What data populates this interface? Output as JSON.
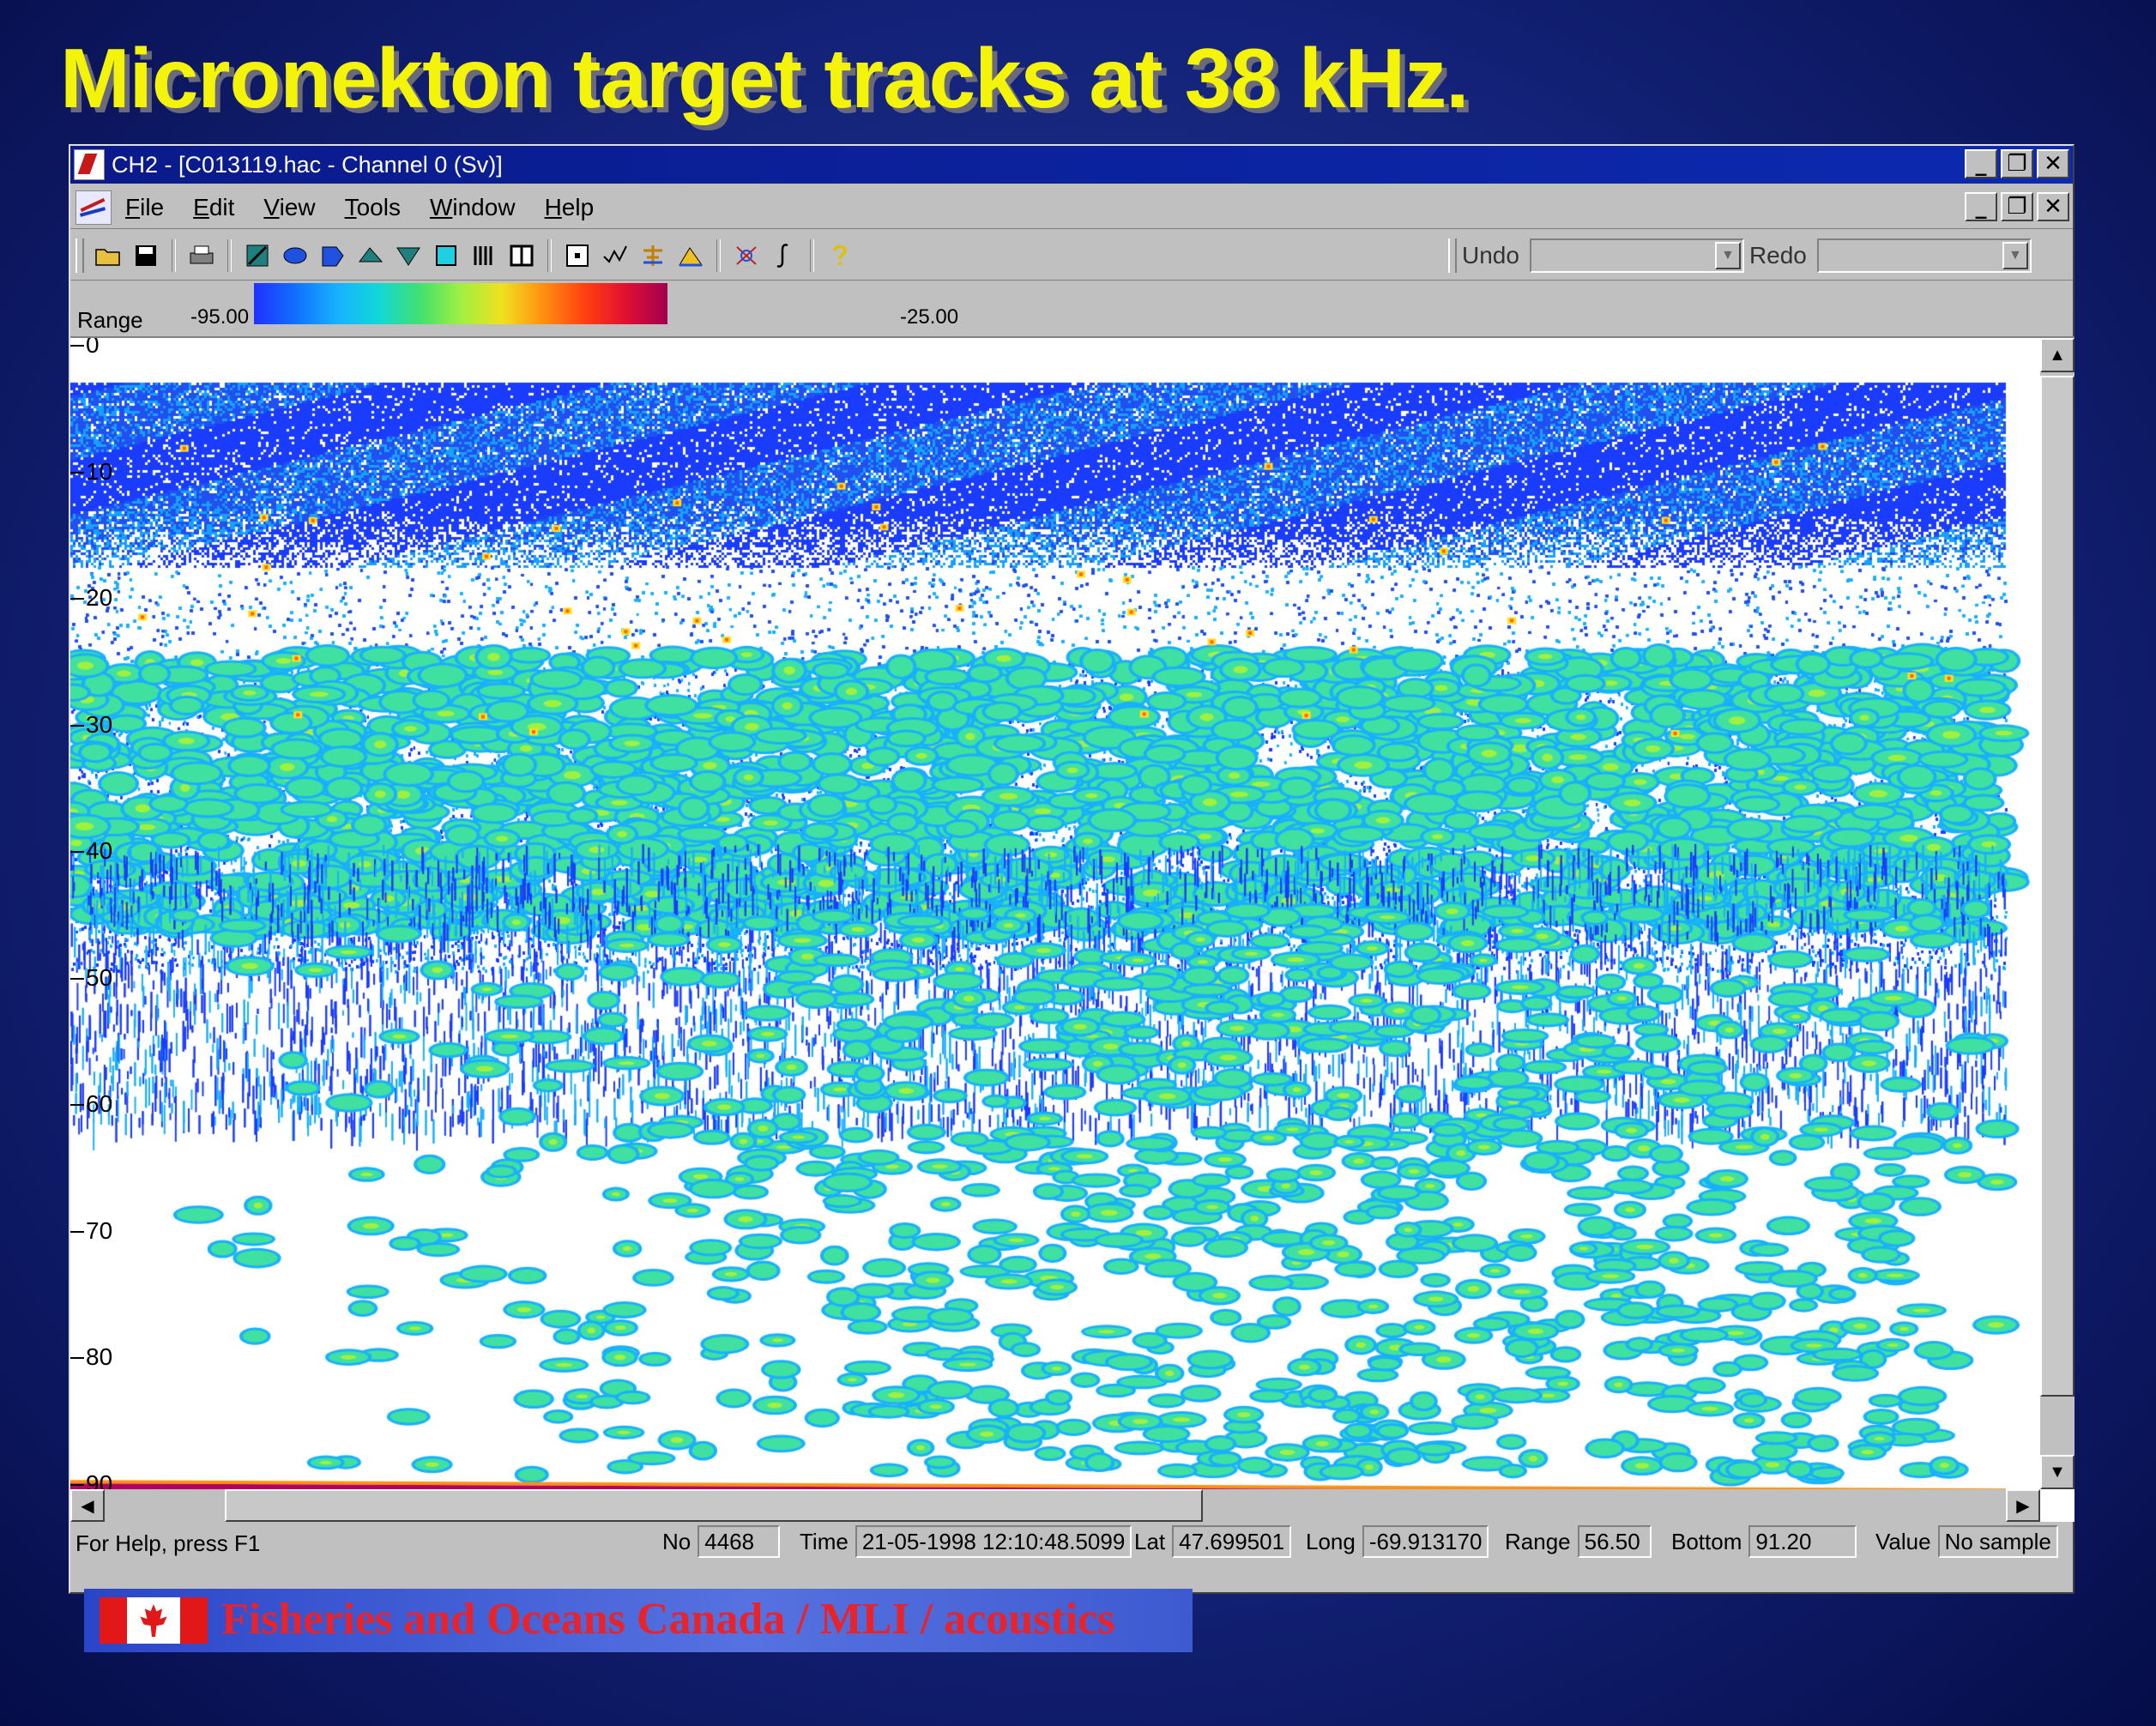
{
  "slide": {
    "title": "Micronekton target tracks at 38 kHz."
  },
  "window": {
    "title": "CH2 - [C013119.hac - Channel 0 (Sv)]",
    "controls": [
      "_",
      "❐",
      "✕"
    ]
  },
  "menu": {
    "items": [
      "File",
      "Edit",
      "View",
      "Tools",
      "Window",
      "Help"
    ]
  },
  "toolbar": {
    "undo_label": "Undo",
    "redo_label": "Redo",
    "undo_value": "",
    "redo_value": ""
  },
  "colorbar": {
    "label": "Range",
    "min_label": "-95.00",
    "max_label": "-25.00"
  },
  "echogram": {
    "depth_labels": [
      "0",
      "10",
      "20",
      "30",
      "40",
      "50",
      "60",
      "70",
      "80",
      "90"
    ],
    "depth_values": [
      0,
      10,
      20,
      30,
      40,
      50,
      60,
      70,
      80,
      90
    ],
    "bottom_depth": 91.2,
    "colors": {
      "low": "#1a3cff",
      "mid": "#30e090",
      "high": "#ffe020",
      "bottom": "#b00060"
    }
  },
  "status": {
    "help": "For Help, press F1",
    "no_label": "No",
    "no_value": "4468",
    "time_label": "Time",
    "time_value": "21-05-1998 12:10:48.5099",
    "lat_label": "Lat",
    "lat_value": "47.699501",
    "long_label": "Long",
    "long_value": "-69.913170",
    "range_label": "Range",
    "range_value": "56.50",
    "bottom_label": "Bottom",
    "bottom_value": "91.20",
    "value_label": "Value",
    "value_value": "No sample"
  },
  "footer": {
    "text": "Fisheries and Oceans Canada / MLI / acoustics"
  }
}
